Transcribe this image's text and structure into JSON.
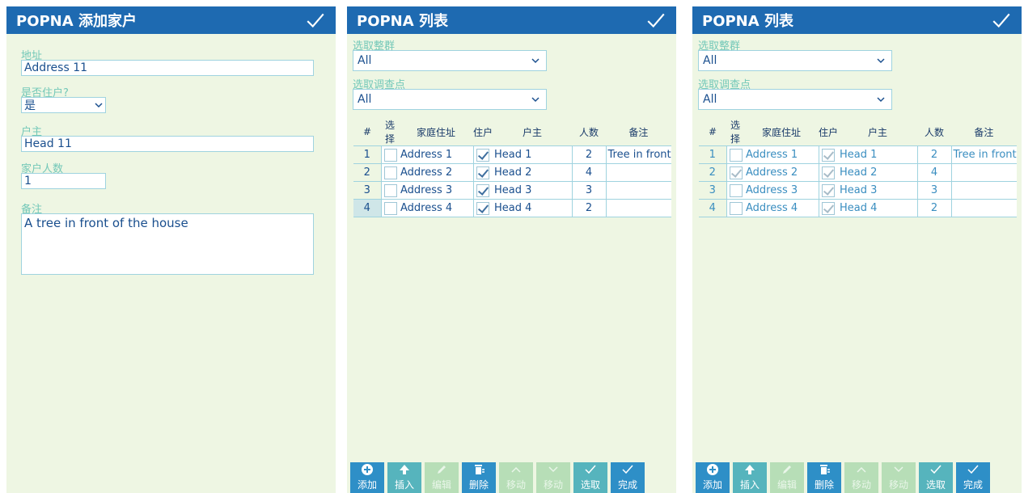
{
  "add_screen": {
    "title": "POPNA 添加家户",
    "fields": {
      "address_label": "地址",
      "address_value": "Address 11",
      "resident_label": "是否住户?",
      "resident_value": "是",
      "head_label": "户主",
      "head_value": "Head 11",
      "count_label": "家户人数",
      "count_value": "1",
      "notes_label": "备注",
      "notes_value": "A tree in front of the house"
    }
  },
  "list_screen": {
    "title": "POPNA 列表",
    "cluster_label": "选取整群",
    "cluster_value": "All",
    "point_label": "选取调查点",
    "point_value": "All",
    "columns": [
      "#",
      "选择",
      "家庭住址",
      "住户",
      "户主",
      "人数",
      "备注"
    ],
    "rows_a": [
      {
        "n": "1",
        "addr": "Address 1",
        "head": "Head 1",
        "cnt": "2",
        "note": "Tree in front",
        "selected": false,
        "resident": true
      },
      {
        "n": "2",
        "addr": "Address 2",
        "head": "Head 2",
        "cnt": "4",
        "note": "",
        "selected": false,
        "resident": true
      },
      {
        "n": "3",
        "addr": "Address 3",
        "head": "Head 3",
        "cnt": "3",
        "note": "",
        "selected": false,
        "resident": true
      },
      {
        "n": "4",
        "addr": "Address 4",
        "head": "Head 4",
        "cnt": "2",
        "note": "",
        "selected": false,
        "resident": true
      }
    ],
    "rows_b": [
      {
        "n": "1",
        "addr": "Address 1",
        "head": "Head 1",
        "cnt": "2",
        "note": "Tree in front",
        "selected": false,
        "resident": true
      },
      {
        "n": "2",
        "addr": "Address 2",
        "head": "Head 2",
        "cnt": "4",
        "note": "",
        "selected": true,
        "resident": true
      },
      {
        "n": "3",
        "addr": "Address 3",
        "head": "Head 3",
        "cnt": "3",
        "note": "",
        "selected": false,
        "resident": true
      },
      {
        "n": "4",
        "addr": "Address 4",
        "head": "Head 4",
        "cnt": "2",
        "note": "",
        "selected": false,
        "resident": true
      }
    ],
    "toolbar": [
      {
        "label": "添加",
        "icon": "plus-circle-icon",
        "style": "blue"
      },
      {
        "label": "插入",
        "icon": "arrow-up-icon",
        "style": "teal"
      },
      {
        "label": "编辑",
        "icon": "pencil-icon",
        "style": "disabled"
      },
      {
        "label": "删除",
        "icon": "trash-icon",
        "style": "blue"
      },
      {
        "label": "移动",
        "icon": "chevron-up-icon",
        "style": "disabled"
      },
      {
        "label": "移动",
        "icon": "chevron-down-icon",
        "style": "disabled"
      },
      {
        "label": "选取",
        "icon": "check-icon",
        "style": "teal"
      },
      {
        "label": "完成",
        "icon": "check-icon",
        "style": "blue"
      }
    ]
  },
  "colors": {
    "header": "#1e6ab1",
    "background": "#eef6e3",
    "label": "#73c8b8",
    "text": "#1a4f8e"
  }
}
